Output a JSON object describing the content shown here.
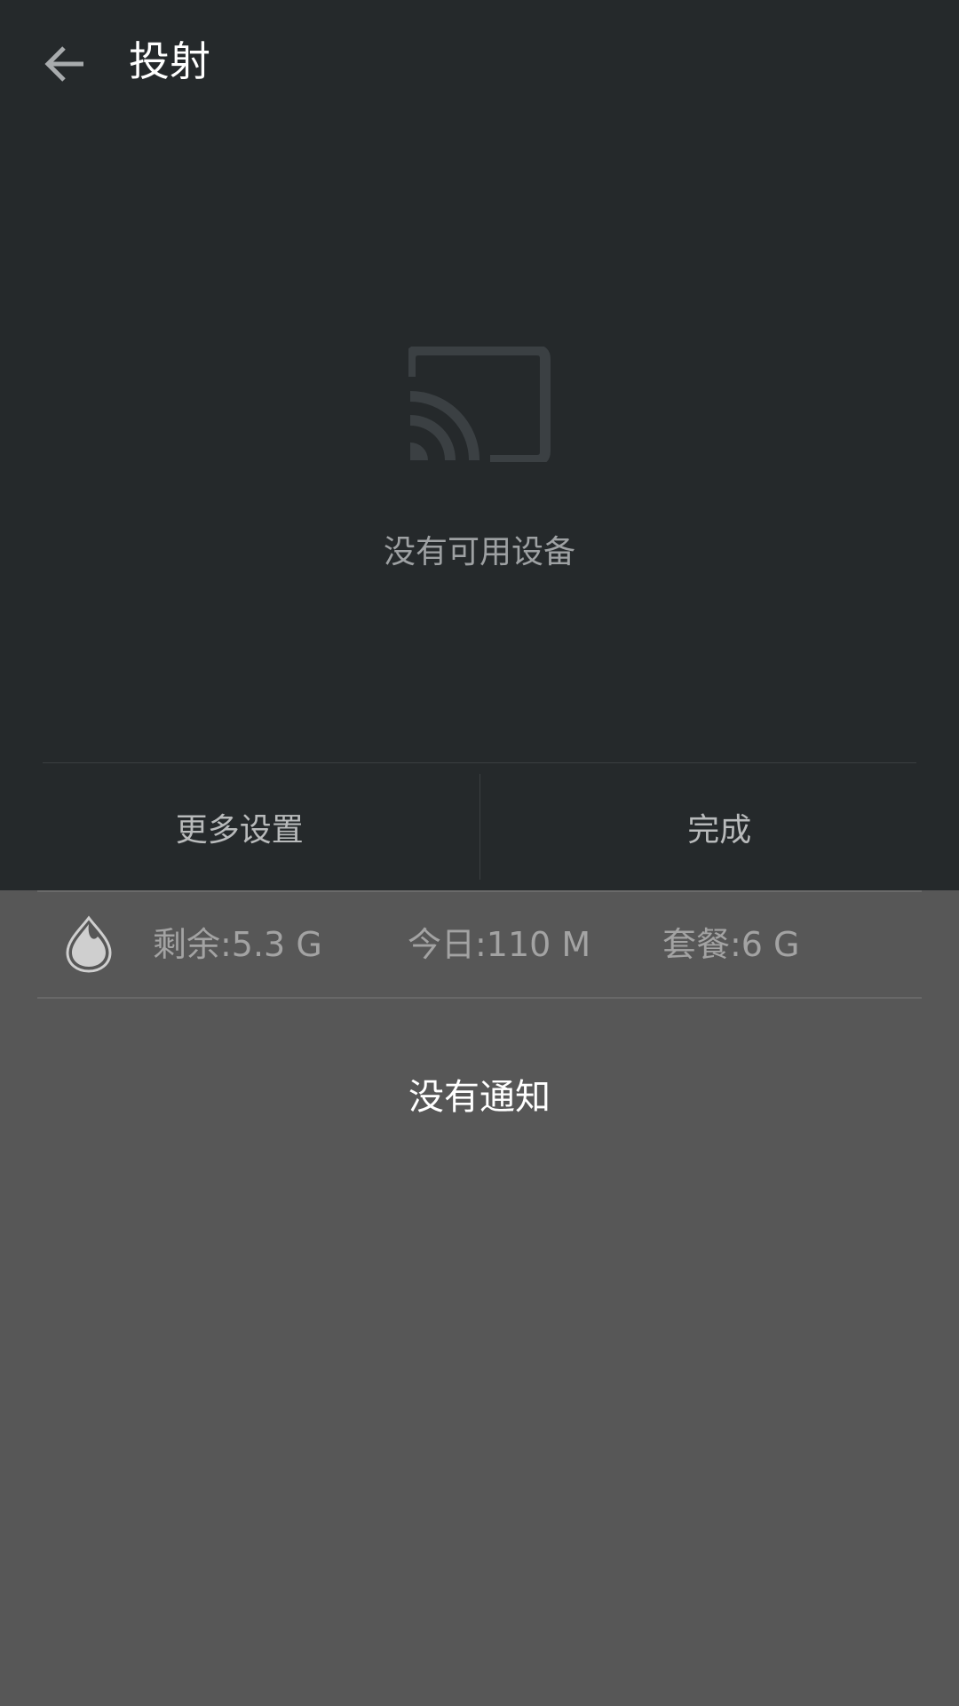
{
  "header": {
    "title": "投射",
    "back_icon": "arrow-left-icon"
  },
  "cast": {
    "icon": "cast-icon",
    "empty_message": "没有可用设备"
  },
  "actions": {
    "more_settings": "更多设置",
    "done": "完成"
  },
  "data_usage": {
    "icon": "water-drop-icon",
    "remaining": "剩余:5.3 G",
    "today": "今日:110 M",
    "plan": "套餐:6 G"
  },
  "notifications": {
    "empty_message": "没有通知"
  },
  "colors": {
    "panel_bg": "#25292b",
    "shade_bg": "#575757",
    "title_text": "#ffffff",
    "muted_text": "#9ea1a3"
  }
}
